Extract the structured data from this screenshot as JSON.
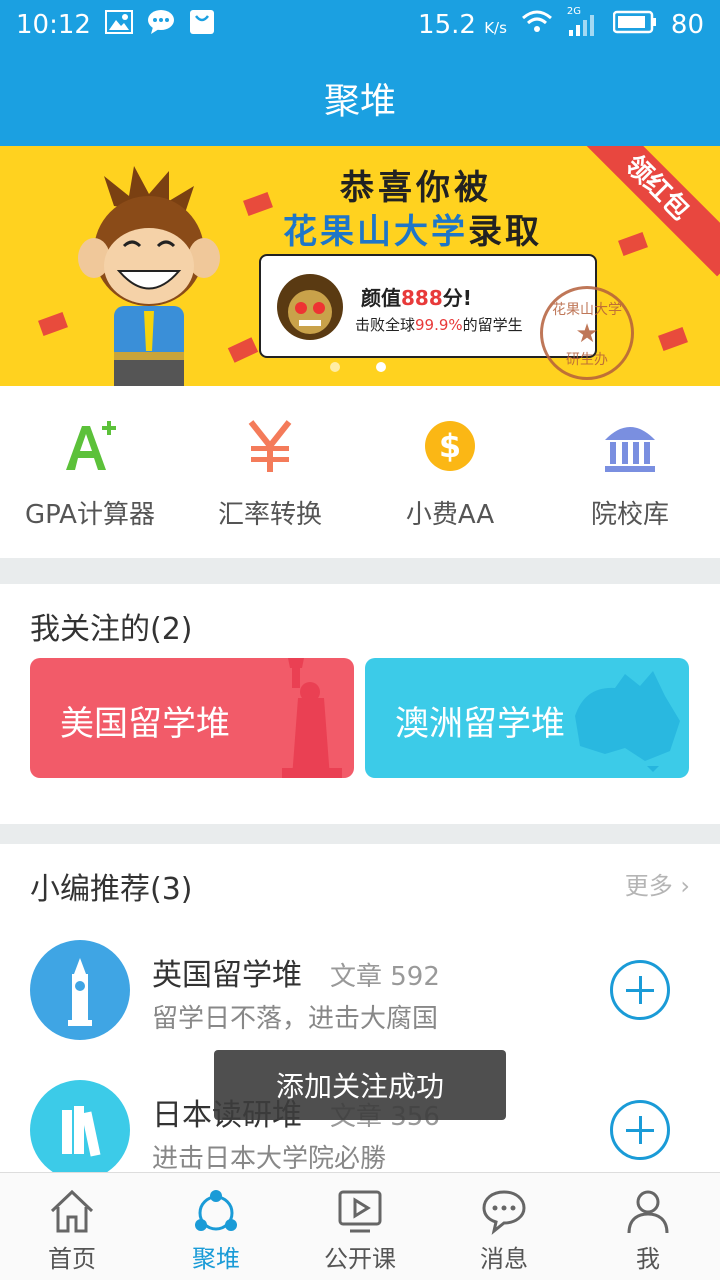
{
  "status_bar": {
    "time": "10:12",
    "network_speed": "15.2",
    "speed_unit": "K/s",
    "network_type": "2G",
    "battery": "80"
  },
  "header": {
    "title": "聚堆"
  },
  "banner": {
    "headline_line1": "恭喜你被",
    "headline_school": "花果山大学",
    "headline_suffix": "录取",
    "card_line1_prefix": "颜值",
    "card_line1_score": "888",
    "card_line1_suffix": "分!",
    "card_line2_prefix": "击败全球",
    "card_line2_percent": "99.9%",
    "card_line2_suffix": "的留学生",
    "ribbon": "领红包",
    "stamp_top": "花果山大学",
    "stamp_bottom": "研生办",
    "slides": 2,
    "active_slide": 2
  },
  "tools": [
    {
      "label": "GPA计算器",
      "icon": "a-plus-icon"
    },
    {
      "label": "汇率转换",
      "icon": "yen-icon"
    },
    {
      "label": "小费AA",
      "icon": "dollar-icon"
    },
    {
      "label": "院校库",
      "icon": "institution-icon"
    }
  ],
  "following": {
    "title": "我关注的(2)",
    "items": [
      {
        "label": "美国留学堆",
        "color": "#f25b69"
      },
      {
        "label": "澳洲留学堆",
        "color": "#3ccbe8"
      }
    ]
  },
  "recommend": {
    "title": "小编推荐(3)",
    "more": "更多",
    "items": [
      {
        "name": "英国留学堆",
        "count": "文章 592",
        "desc": "留学日不落，进击大腐国",
        "color": "#3fa5e4"
      },
      {
        "name": "日本读研堆",
        "count": "文章 356",
        "desc": "进击日本大学院必勝",
        "color": "#3ccbe8"
      }
    ]
  },
  "toast": "添加关注成功",
  "tabs": [
    {
      "label": "首页",
      "active": false
    },
    {
      "label": "聚堆",
      "active": true
    },
    {
      "label": "公开课",
      "active": false
    },
    {
      "label": "消息",
      "active": false
    },
    {
      "label": "我",
      "active": false
    }
  ]
}
